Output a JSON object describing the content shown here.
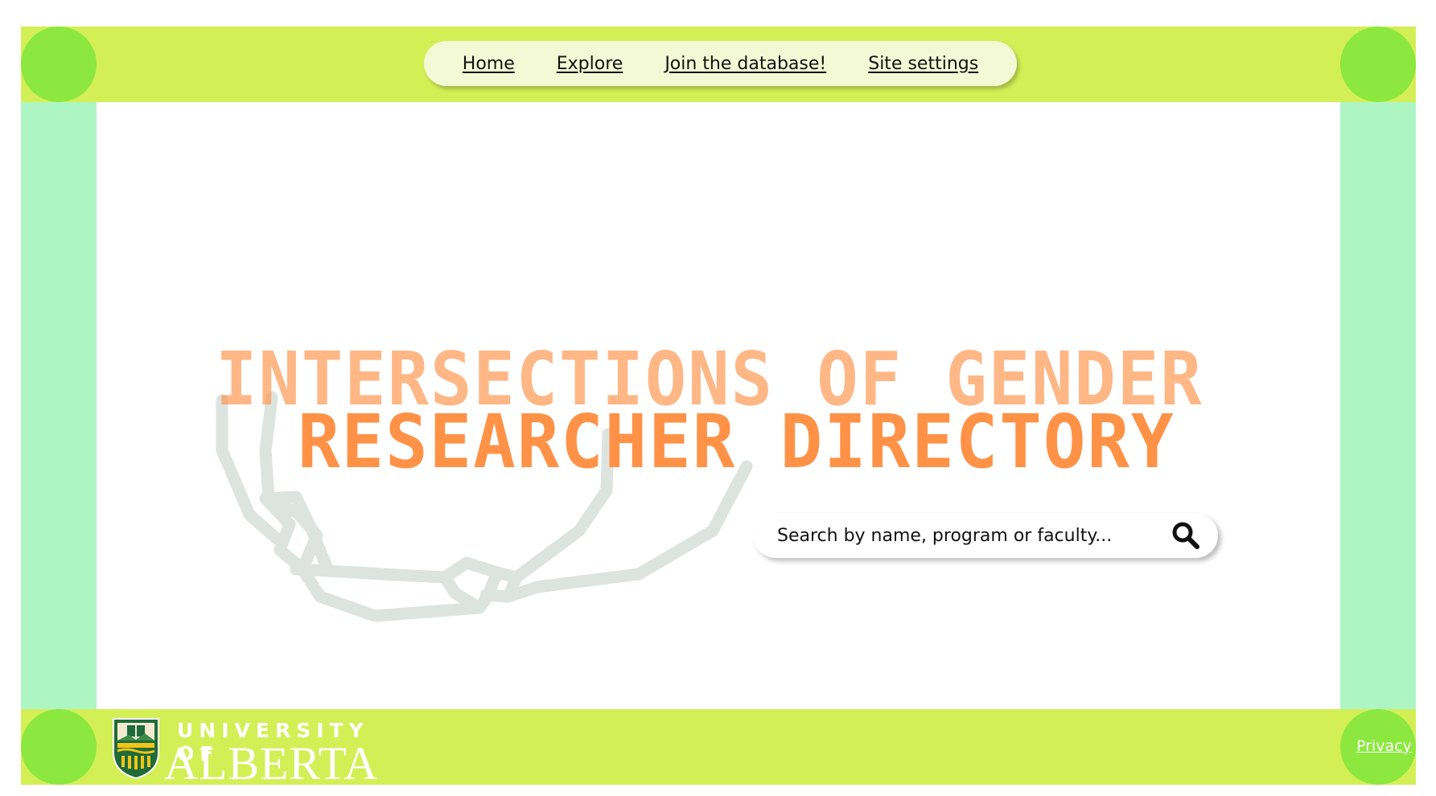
{
  "nav": {
    "items": [
      {
        "label": "Home"
      },
      {
        "label": "Explore"
      },
      {
        "label": "Join the database!"
      },
      {
        "label": "Site settings"
      }
    ]
  },
  "hero": {
    "title_line_1": "INTERSECTIONS OF GENDER",
    "title_line_2": "RESEARCHER DIRECTORY"
  },
  "search": {
    "placeholder": "Search by name, program or faculty...",
    "value": "",
    "icon": "search-icon"
  },
  "footer": {
    "logo_line_1": "UNIVERSITY OF",
    "logo_line_2": "ALBERTA",
    "privacy_label": "Privacy"
  },
  "colors": {
    "frame_top_bottom": "#d3ef55",
    "frame_sides": "#adf6c4",
    "corners": "#8ce83e",
    "nav_pill": "#f3f9d4",
    "title": "#ff9246",
    "chain": "#dde3df"
  }
}
